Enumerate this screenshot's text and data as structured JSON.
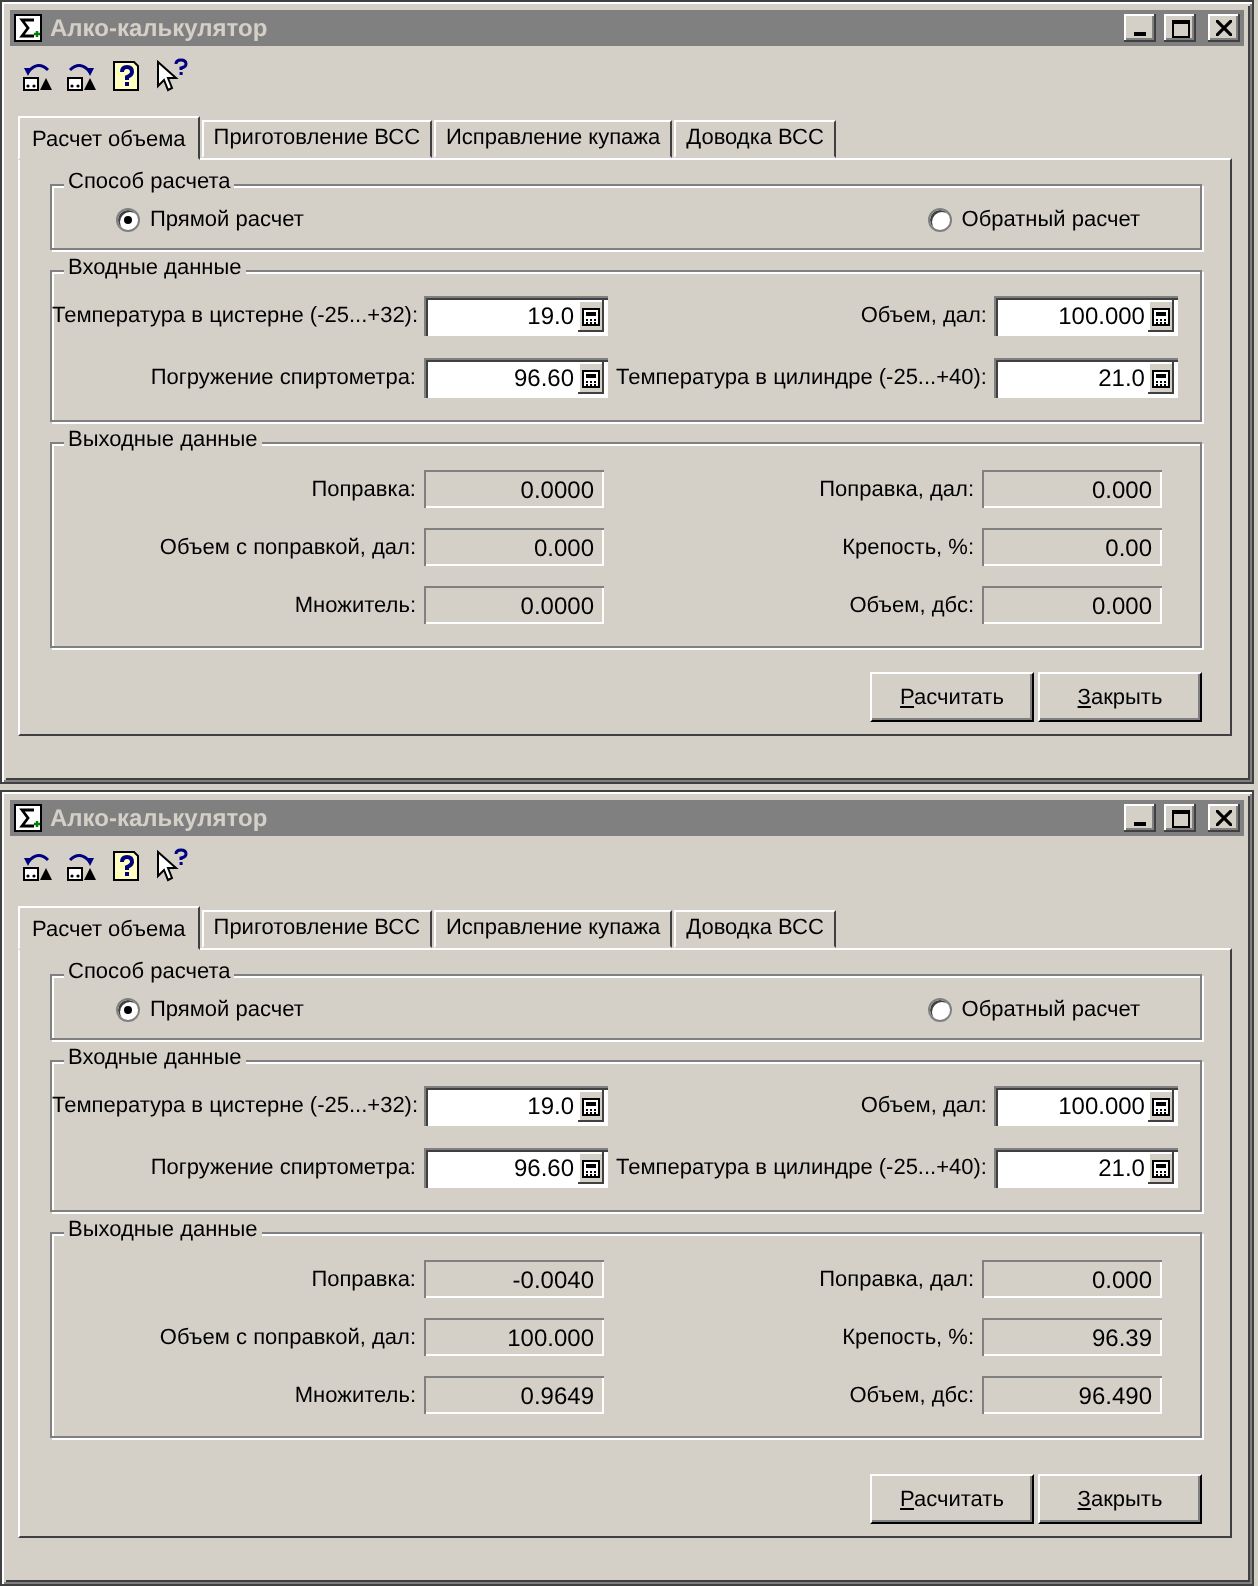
{
  "windows": [
    {
      "title": "Алко-калькулятор",
      "toolbar": [
        {
          "kind": "undo"
        },
        {
          "kind": "redo"
        },
        {
          "kind": "help"
        },
        {
          "kind": "whatsthis"
        }
      ],
      "tabs": [
        {
          "label": "Расчет объема",
          "selected": true
        },
        {
          "label": "Приготовление ВСС",
          "selected": false
        },
        {
          "label": "Исправление купажа",
          "selected": false
        },
        {
          "label": "Доводка ВСС",
          "selected": false
        }
      ],
      "method": {
        "title": "Способ расчета",
        "options": [
          {
            "label": "Прямой расчет",
            "selected": true
          },
          {
            "label": "Обратный расчет",
            "selected": false
          }
        ]
      },
      "inputs": {
        "title": "Входные данные",
        "fields": [
          {
            "label": "Температура в цистерне (-25...+32):",
            "value": "19.0"
          },
          {
            "label": "Объем, дал:",
            "value": "100.000"
          },
          {
            "label": "Погружение спиртометра:",
            "value": "96.60"
          },
          {
            "label": "Температура в цилиндре (-25...+40):",
            "value": "21.0"
          }
        ]
      },
      "outputs": {
        "title": "Выходные данные",
        "fields": [
          {
            "label": "Поправка:",
            "value": "0.0000"
          },
          {
            "label": "Поправка, дал:",
            "value": "0.000"
          },
          {
            "label": "Объем с поправкой, дал:",
            "value": "0.000"
          },
          {
            "label": "Крепость, %:",
            "value": "0.00"
          },
          {
            "label": "Множитель:",
            "value": "0.0000"
          },
          {
            "label": "Объем, дбс:",
            "value": "0.000"
          }
        ]
      },
      "buttons": [
        {
          "label": "Расчитать",
          "accelerator_underlined": true
        },
        {
          "label": "Закрыть",
          "accelerator_underlined": true
        }
      ]
    },
    {
      "title": "Алко-калькулятор",
      "toolbar": [
        {
          "kind": "undo"
        },
        {
          "kind": "redo"
        },
        {
          "kind": "help"
        },
        {
          "kind": "whatsthis"
        }
      ],
      "tabs": [
        {
          "label": "Расчет объема",
          "selected": true
        },
        {
          "label": "Приготовление ВСС",
          "selected": false
        },
        {
          "label": "Исправление купажа",
          "selected": false
        },
        {
          "label": "Доводка ВСС",
          "selected": false
        }
      ],
      "method": {
        "title": "Способ расчета",
        "options": [
          {
            "label": "Прямой расчет",
            "selected": true
          },
          {
            "label": "Обратный расчет",
            "selected": false
          }
        ]
      },
      "inputs": {
        "title": "Входные данные",
        "fields": [
          {
            "label": "Температура в цистерне (-25...+32):",
            "value": "19.0"
          },
          {
            "label": "Объем, дал:",
            "value": "100.000"
          },
          {
            "label": "Погружение спиртометра:",
            "value": "96.60"
          },
          {
            "label": "Температура в цилиндре (-25...+40):",
            "value": "21.0"
          }
        ]
      },
      "outputs": {
        "title": "Выходные данные",
        "fields": [
          {
            "label": "Поправка:",
            "value": "-0.0040"
          },
          {
            "label": "Поправка, дал:",
            "value": "0.000"
          },
          {
            "label": "Объем с поправкой, дал:",
            "value": "100.000"
          },
          {
            "label": "Крепость, %:",
            "value": "96.39"
          },
          {
            "label": "Множитель:",
            "value": "0.9649"
          },
          {
            "label": "Объем, дбс:",
            "value": "96.490"
          }
        ]
      },
      "buttons": [
        {
          "label": "Расчитать",
          "accelerator_underlined": true
        },
        {
          "label": "Закрыть",
          "accelerator_underlined": true
        }
      ]
    }
  ]
}
